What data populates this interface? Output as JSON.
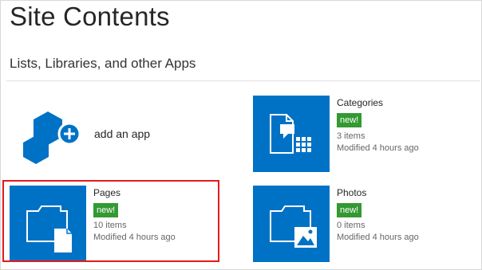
{
  "page_title": "Site Contents",
  "section_heading": "Lists, Libraries, and other Apps",
  "add_app": {
    "label": "add an app",
    "icon": "add-app-hexagon-icon"
  },
  "apps": [
    {
      "id": "categories",
      "title": "Categories",
      "badge": "new!",
      "items": "3 items",
      "modified": "Modified 4 hours ago",
      "icon": "custom-list-icon"
    },
    {
      "id": "pages",
      "title": "Pages",
      "badge": "new!",
      "items": "10 items",
      "modified": "Modified 4 hours ago",
      "icon": "document-library-icon",
      "highlighted": true
    },
    {
      "id": "photos",
      "title": "Photos",
      "badge": "new!",
      "items": "0 items",
      "modified": "Modified 4 hours ago",
      "icon": "picture-library-icon"
    }
  ],
  "colors": {
    "tile": "#0072c6",
    "badge": "#339933",
    "highlight": "#e21b1b"
  }
}
